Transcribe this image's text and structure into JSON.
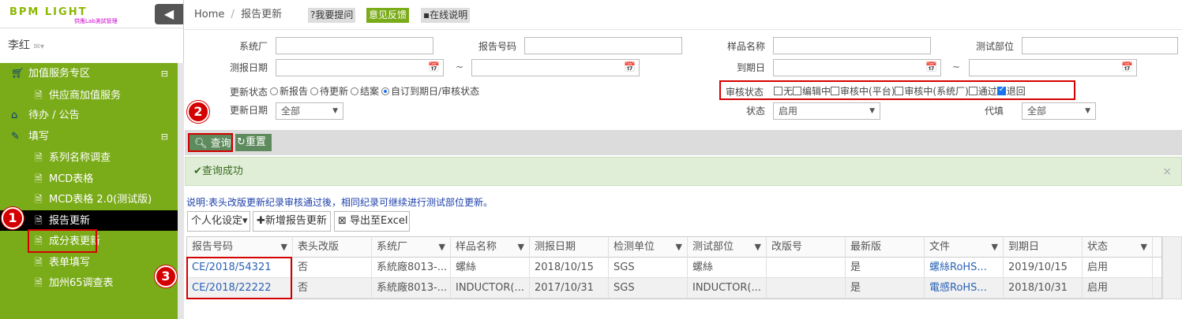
{
  "app": {
    "logo_text": "BPM LIGHT",
    "logo_sub": "供應Lab測試管理",
    "collapse_icon": "◀",
    "user_name": "李红"
  },
  "sidebar": {
    "items": [
      {
        "label": "加值服务专区",
        "icon": "cart-icon",
        "level": "top",
        "toggle": "⊟"
      },
      {
        "label": "供应商加值服务",
        "icon": "doc-icon",
        "level": "sub"
      },
      {
        "label": "待办 / 公告",
        "icon": "home-icon",
        "level": "top"
      },
      {
        "label": "填写",
        "icon": "edit-icon",
        "level": "top",
        "toggle": "⊟"
      },
      {
        "label": "系列名称调查",
        "icon": "doc-icon",
        "level": "sub"
      },
      {
        "label": "MCD表格",
        "icon": "doc-icon",
        "level": "sub"
      },
      {
        "label": "MCD表格 2.0(测试版)",
        "icon": "doc-icon",
        "level": "sub"
      },
      {
        "label": "报告更新",
        "icon": "doc-icon",
        "level": "sub",
        "active": true
      },
      {
        "label": "成分表更新",
        "icon": "doc-icon",
        "level": "sub"
      },
      {
        "label": "表单填写",
        "icon": "doc-icon",
        "level": "sub"
      },
      {
        "label": "加州65调查表",
        "icon": "doc-icon",
        "level": "sub"
      }
    ]
  },
  "breadcrumb": {
    "home": "Home",
    "sep": "/",
    "current": "报告更新"
  },
  "topbuttons": {
    "ask": "?我要提问",
    "feedback": "意见反馈",
    "help": "在线说明"
  },
  "filters": {
    "vendor_label": "系统厂",
    "report_no_label": "报告号码",
    "sample_label": "样品名称",
    "dept_label": "测试部位",
    "test_date_label": "测报日期",
    "expire_label": "到期日",
    "tilde": "~",
    "update_status_label": "更新状态",
    "update_status_options": [
      "新报告",
      "待更新",
      "结案",
      "自订到期日/审核状态"
    ],
    "update_status_selected": 3,
    "audit_label": "审核状态",
    "audit_options": [
      "无",
      "编辑中",
      "审核中(平台)",
      "审核中(系统厂)",
      "通过",
      "退回"
    ],
    "audit_checked": [
      false,
      false,
      false,
      false,
      false,
      true
    ],
    "update_date_label": "更新日期",
    "update_date_value": "全部",
    "status_label": "状态",
    "status_value": "启用",
    "proxy_label": "代填",
    "proxy_value": "全部"
  },
  "actions": {
    "search": "查询",
    "reset": "重置"
  },
  "alert": {
    "text": "查询成功",
    "close": "×"
  },
  "note": "说明:表头改版更新纪录审核通过後，相同纪录可继续进行测试部位更新。",
  "toolbar": {
    "personalize": "个人化设定",
    "add_report": "新增报告更新",
    "export": "导出至Excel"
  },
  "table": {
    "headers": [
      "报告号码",
      "表头改版",
      "系统厂",
      "样品名称",
      "测报日期",
      "检测单位",
      "测试部位",
      "改版号",
      "最新版",
      "文件",
      "到期日",
      "状态"
    ],
    "rows": [
      [
        "CE/2018/54321",
        "否",
        "系統廠8013-...",
        "螺絲",
        "2018/10/15",
        "SGS",
        "螺絲",
        "",
        "是",
        "螺絲RoHS...",
        "2019/10/15",
        "启用"
      ],
      [
        "CE/2018/22222",
        "否",
        "系統廠8013-...",
        "INDUCTOR(...",
        "2017/10/31",
        "SGS",
        "INDUCTOR(...",
        "",
        "是",
        "電感RoHS...",
        "2018/10/31",
        "启用"
      ]
    ]
  },
  "badges": [
    "1",
    "2",
    "3"
  ],
  "colors": {
    "sidebar_green": "#7aab19",
    "highlight_red": "#d40000",
    "button_green": "#5e8b5e",
    "link_blue": "#2a62b5"
  }
}
